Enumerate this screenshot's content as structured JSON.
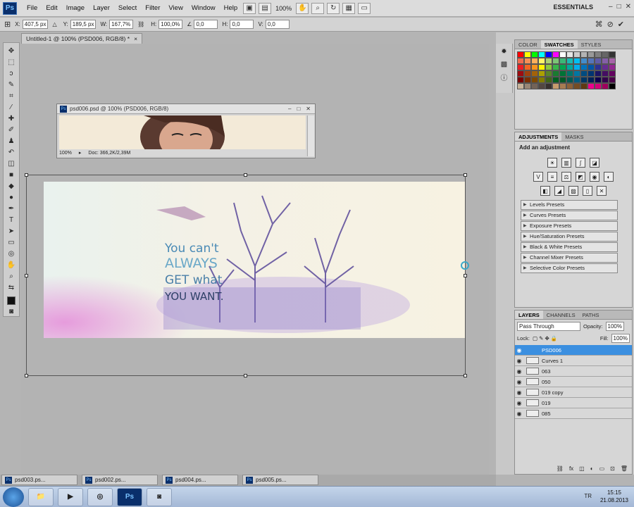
{
  "menubar": {
    "logo": "Ps",
    "items": [
      "File",
      "Edit",
      "Image",
      "Layer",
      "Select",
      "Filter",
      "View",
      "Window",
      "Help"
    ],
    "zoom": "100%",
    "workspace": "ESSENTIALS"
  },
  "options": {
    "x_label": "X:",
    "x_value": "407,5 px",
    "y_label": "Y:",
    "y_value": "189,5 px",
    "w_label": "W:",
    "w_value": "167,7%",
    "h_label": "H:",
    "h_value": "100,0%",
    "rot_value": "0,0",
    "hskew_label": "H:",
    "hskew_value": "0,0",
    "vskew_label": "V:",
    "vskew_value": "0,0"
  },
  "doctab": {
    "title": "Untitled-1 @ 100% (PSD006, RGB/8) *",
    "close": "×"
  },
  "floatwin": {
    "title": "psd006.psd @ 100% (PSD006, RGB/8)",
    "zoom": "100%",
    "doc": "Doc: 366,2K/2,39M"
  },
  "artwork": {
    "lines": [
      "You can't",
      "ALWAYS",
      "GET what",
      "YOU WANT."
    ]
  },
  "swatches": {
    "tabs": [
      "COLOR",
      "SWATCHES",
      "STYLES"
    ],
    "colors": [
      "#ff0000",
      "#ffff00",
      "#00ff00",
      "#00ffff",
      "#0000ff",
      "#ff00ff",
      "#ffffff",
      "#e6e6e6",
      "#cccccc",
      "#b3b3b3",
      "#999999",
      "#808080",
      "#666666",
      "#333333",
      "#f26c4f",
      "#f68e55",
      "#fbaf5c",
      "#fff467",
      "#acd372",
      "#7cc576",
      "#3bb878",
      "#1abbb4",
      "#00bff3",
      "#438ccb",
      "#5574b9",
      "#605ca8",
      "#855fa8",
      "#a763a8",
      "#ed1c24",
      "#f26522",
      "#f7941d",
      "#fff200",
      "#8dc73f",
      "#39b54a",
      "#00a651",
      "#00a99d",
      "#00aeef",
      "#0072bc",
      "#0054a6",
      "#2e3192",
      "#662d91",
      "#92278f",
      "#9e0b0f",
      "#a0410d",
      "#a36209",
      "#aba000",
      "#598527",
      "#1a7b30",
      "#007236",
      "#00746b",
      "#0076a3",
      "#004b80",
      "#003471",
      "#1b1464",
      "#440e62",
      "#630460",
      "#790000",
      "#7b2e00",
      "#7d4900",
      "#827b00",
      "#406618",
      "#005e20",
      "#005826",
      "#005952",
      "#005b7f",
      "#003663",
      "#002157",
      "#0d004c",
      "#32004b",
      "#4b0049",
      "#c7b299",
      "#998675",
      "#736357",
      "#534741",
      "#37302d",
      "#c69c6d",
      "#a67c52",
      "#8c6239",
      "#754c24",
      "#603913",
      "#ec008c",
      "#d4007a",
      "#9e005d",
      "#000000"
    ]
  },
  "adjustments": {
    "tabs": [
      "ADJUSTMENTS",
      "MASKS"
    ],
    "title": "Add an adjustment",
    "presets": [
      "Levels Presets",
      "Curves Presets",
      "Exposure Presets",
      "Hue/Saturation Presets",
      "Black & White Presets",
      "Channel Mixer Presets",
      "Selective Color Presets"
    ]
  },
  "layers": {
    "tabs": [
      "LAYERS",
      "CHANNELS",
      "PATHS"
    ],
    "blend": "Pass Through",
    "opacity_label": "Opacity:",
    "opacity": "100%",
    "lock_label": "Lock:",
    "fill_label": "Fill:",
    "fill": "100%",
    "rows": [
      {
        "name": "PSD006",
        "selected": true
      },
      {
        "name": "Curves 1",
        "selected": false
      },
      {
        "name": "063",
        "selected": false
      },
      {
        "name": "050",
        "selected": false
      },
      {
        "name": "019 copy",
        "selected": false
      },
      {
        "name": "019",
        "selected": false
      },
      {
        "name": "085",
        "selected": false
      }
    ]
  },
  "bottomtabs": [
    "psd003.ps...",
    "psd002.ps...",
    "psd004.ps...",
    "psd005.ps..."
  ],
  "taskbar": {
    "ps": "Ps",
    "lang": "TR",
    "time": "15:15",
    "date": "21.08.2013"
  }
}
